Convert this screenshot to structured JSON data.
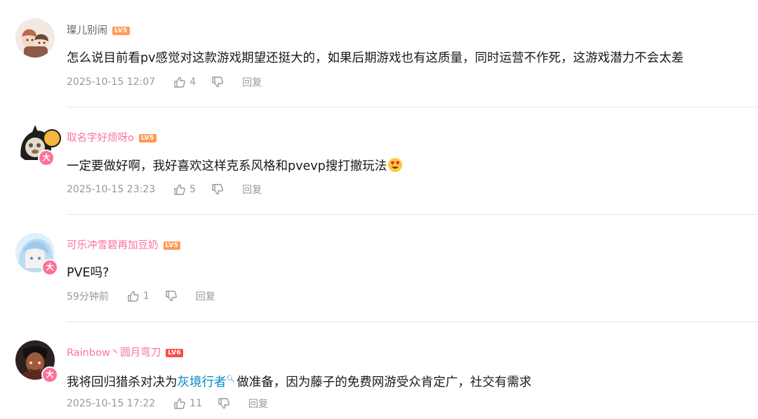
{
  "comments": [
    {
      "username": "璨儿别闹",
      "level": "LV5",
      "content": "怎么说目前看pv感觉对这款游戏期望还挺大的，如果后期游戏也有这质量，同时运营不作死，这游戏潜力不会太差",
      "time": "2025-10-15 12:07",
      "likes": "4",
      "reply_label": "回复"
    },
    {
      "username": "取名字好烦呀o",
      "level": "LV5",
      "vip_badge": "大",
      "content": "一定要做好啊，我好喜欢这样克系风格和pvevp搜打撤玩法",
      "emoji": "heart-eyes-emoji",
      "time": "2025-10-15 23:23",
      "likes": "5",
      "reply_label": "回复"
    },
    {
      "username": "可乐冲雪碧再加豆奶",
      "level": "LV5",
      "vip_badge": "大",
      "content": "PVE吗?",
      "time": "59分钟前",
      "likes": "1",
      "reply_label": "回复"
    },
    {
      "username": "Rainbow丶圆月弯刀",
      "level": "LV6",
      "vip_badge": "大",
      "content_before": "我将回归猎杀对决为",
      "content_link": "灰境行者",
      "content_after": "做准备，因为藤子的免费网游受众肯定广，社交有需求",
      "time": "2025-10-15 17:22",
      "likes": "11",
      "reply_label": "回复"
    }
  ],
  "colors": {
    "vip_pink": "#fb7299",
    "level_orange": "#ff9b55",
    "level_red": "#ff4b4b",
    "link_blue": "#008ac5",
    "meta_gray": "#9499a0"
  }
}
